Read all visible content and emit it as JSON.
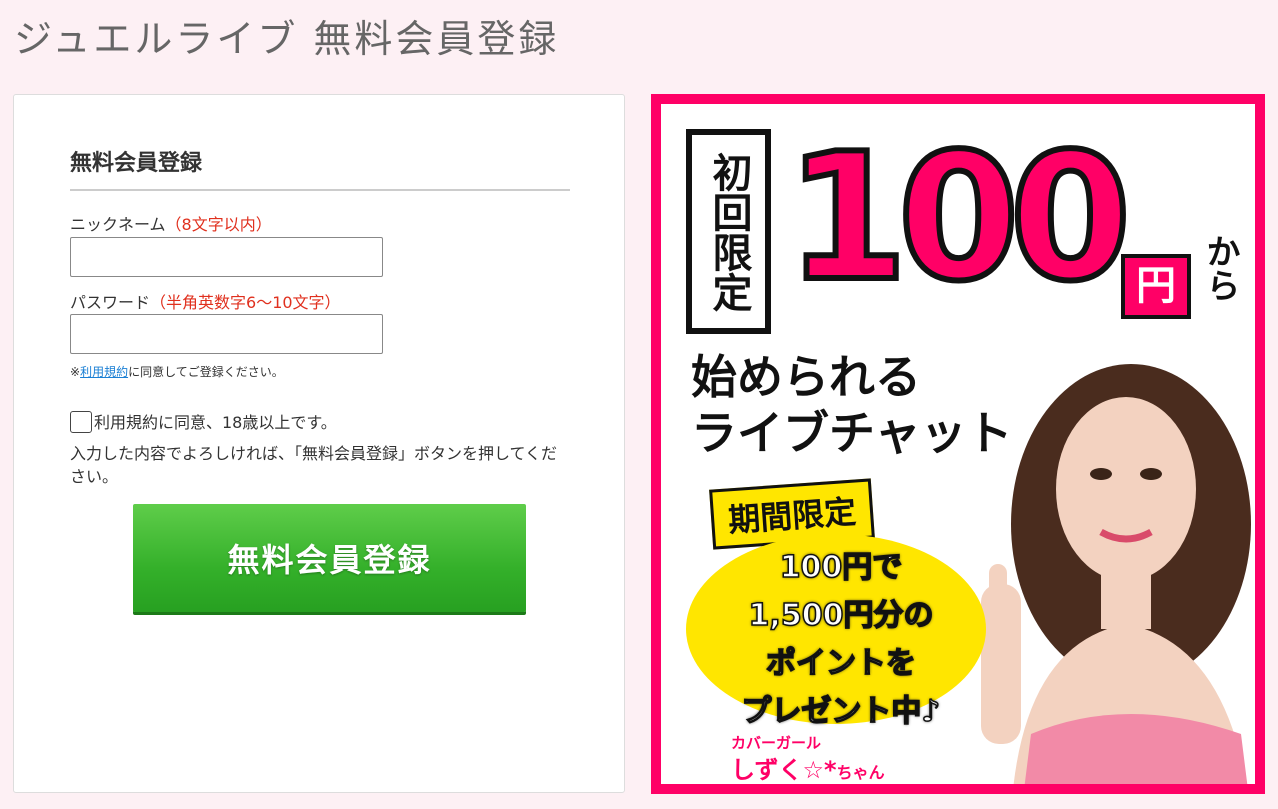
{
  "page": {
    "title": "ジュエルライブ 無料会員登録"
  },
  "form": {
    "heading": "無料会員登録",
    "nickname": {
      "label": "ニックネーム",
      "note": "（8文字以内）",
      "value": ""
    },
    "password": {
      "label": "パスワード",
      "note": "（半角英数字6～10文字）",
      "value": ""
    },
    "terms_note": {
      "prefix": "※",
      "link": "利用規約",
      "suffix": "に同意してご登録ください。"
    },
    "agree_label": "利用規約に同意、18歳以上です。",
    "instruction": "入力した内容でよろしければ、「無料会員登録」ボタンを押してください。",
    "submit_label": "無料会員登録"
  },
  "ad": {
    "badge": "初回限定",
    "price": "100",
    "yen": "円",
    "kara": "から",
    "tagline_1": "始められる",
    "tagline_2": "ライブチャット",
    "period": "期間限定",
    "offer_1": "100円で",
    "offer_2": "1,500円分の",
    "offer_3": "ポイントを",
    "offer_4": "プレゼント中♪",
    "cover_label": "カバーガール",
    "cover_name": "しずく☆*",
    "cover_suffix": "ちゃん",
    "colors": {
      "accent": "#ff0066",
      "burst": "#ffe600"
    }
  },
  "colors": {
    "background": "#fdf0f4",
    "button": "#34b02a",
    "note": "#e0301e",
    "link": "#1a7fd4"
  }
}
